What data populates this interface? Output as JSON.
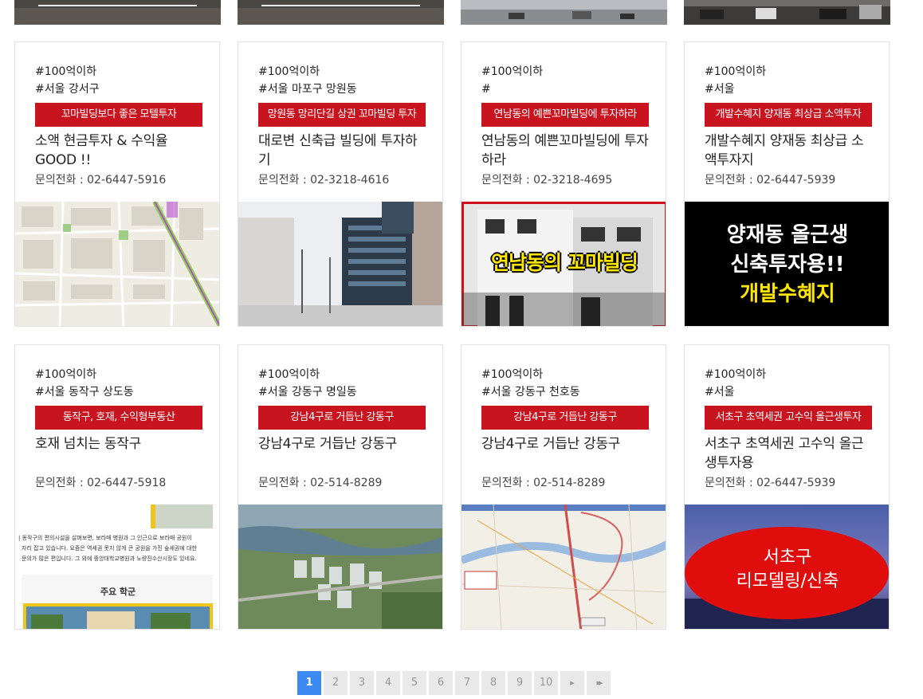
{
  "top_row": [
    {
      "name": "thumb-1"
    },
    {
      "name": "thumb-2"
    },
    {
      "name": "thumb-3"
    },
    {
      "name": "thumb-4"
    }
  ],
  "listings": [
    {
      "price_tag": "#100억이하",
      "location_tag": "#서울 강서구",
      "banner": "꼬마빌딩보다 좋은 모텔투자",
      "title": "소액 현금투자 & 수익율 GOOD !!",
      "phone": "문의전화 : 02-6447-5916"
    },
    {
      "price_tag": "#100억이하",
      "location_tag": "#서울 마포구 망원동",
      "banner": "망원동 망리단길 상권 꼬마빌딩 투자",
      "title": "대로변 신축급 빌딩에 투자하기",
      "phone": "문의전화 : 02-3218-4616"
    },
    {
      "price_tag": "#100억이하",
      "location_tag": "#",
      "banner": "연남동의 예쁜꼬마빌딩에 투자하라",
      "title": "연남동의 예쁜꼬마빌딩에 투자하라",
      "phone": "문의전화 : 02-3218-4695",
      "image_text": "연남동의 꼬마빌딩"
    },
    {
      "price_tag": "#100억이하",
      "location_tag": "#서울",
      "banner": "개발수혜지 양재동 최상급 소액투자",
      "title": "개발수혜지 양재동 최상급 소액투자지",
      "phone": "문의전화 : 02-6447-5939",
      "image_text": [
        "양재동 올근생",
        "신축투자용!!",
        "개발수혜지"
      ]
    },
    {
      "price_tag": "#100억이하",
      "location_tag": "#서울 동작구 상도동",
      "banner": "동작구, 호재, 수익형부동산",
      "title": "호재 넘치는 동작구",
      "phone": "문의전화 : 02-6447-5918",
      "image_text": [
        "| 동작구의 편의시설을 살펴보면, 보라매 병원과 그 인근으로 보라매 공원이",
        "자리 잡고 있습니다. 요즘은 역세권 못지 않게 큰 공원을 가진 숲세권에 대한",
        "문의가 많은 편입니다. 그 외에 중앙대학교병원과 노량진수산시장도 있네요.",
        "주요 학군"
      ]
    },
    {
      "price_tag": "#100억이하",
      "location_tag": "#서울 강동구 명일동",
      "banner": "강남4구로 거듭난 강동구",
      "title": "강남4구로 거듭난 강동구",
      "phone": "문의전화 : 02-514-8289"
    },
    {
      "price_tag": "#100억이하",
      "location_tag": "#서울 강동구 천호동",
      "banner": "강남4구로 거듭난 강동구",
      "title": "강남4구로 거듭난 강동구",
      "phone": "문의전화 : 02-514-8289"
    },
    {
      "price_tag": "#100억이하",
      "location_tag": "#서울",
      "banner": "서초구 초역세권 고수익 올근생투자",
      "title": "서초구 초역세권 고수익 올근생투자용",
      "phone": "문의전화 : 02-6447-5939",
      "image_text": [
        "서초구",
        "리모델링/신축"
      ]
    }
  ],
  "pagination": {
    "pages": [
      "1",
      "2",
      "3",
      "4",
      "5",
      "6",
      "7",
      "8",
      "9",
      "10"
    ],
    "current": "1",
    "next_icon": "chevron-right-icon",
    "last_icon": "double-chevron-right-icon"
  },
  "colors": {
    "banner_red": "#c8141e",
    "pager_active": "#3d8bf2",
    "pager_inactive": "#e9e9e9"
  }
}
